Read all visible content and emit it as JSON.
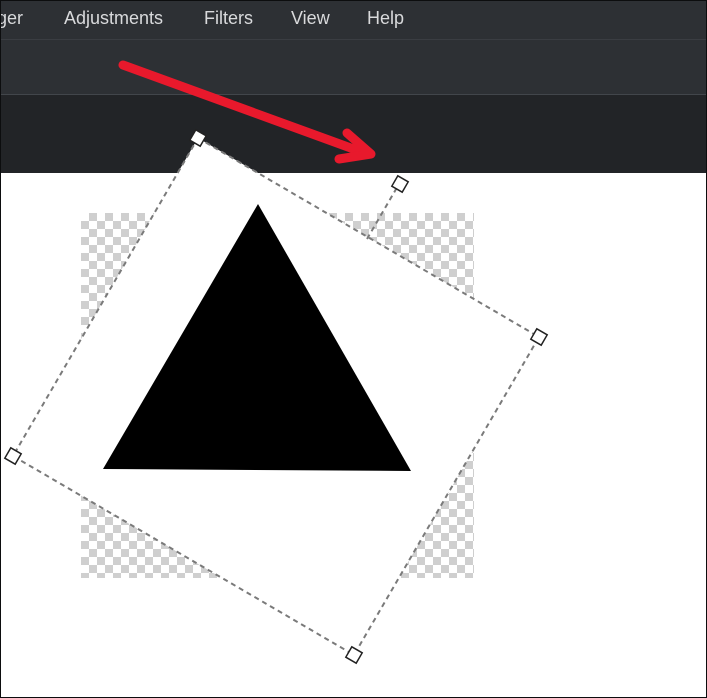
{
  "menubar": {
    "items": [
      {
        "label": "ger"
      },
      {
        "label": "Adjustments"
      },
      {
        "label": "Filters"
      },
      {
        "label": "View"
      },
      {
        "label": "Help"
      }
    ]
  },
  "canvas": {
    "layer_content": "black-triangle",
    "transparency": "checkerboard",
    "selection": "rotated-bounding-box",
    "handles": [
      "rotate-handle",
      "corner-handle-top",
      "corner-handle-right",
      "corner-handle-bottom",
      "corner-handle-left",
      "pivot-handle"
    ]
  },
  "annotation": {
    "arrow_color": "#e8192c"
  },
  "colors": {
    "menubar_bg": "#2d3034",
    "toolbar_bg": "#2d3034",
    "menu_text": "#d9dadc",
    "canvas_bg": "#ffffff",
    "shape_fill": "#000000"
  }
}
